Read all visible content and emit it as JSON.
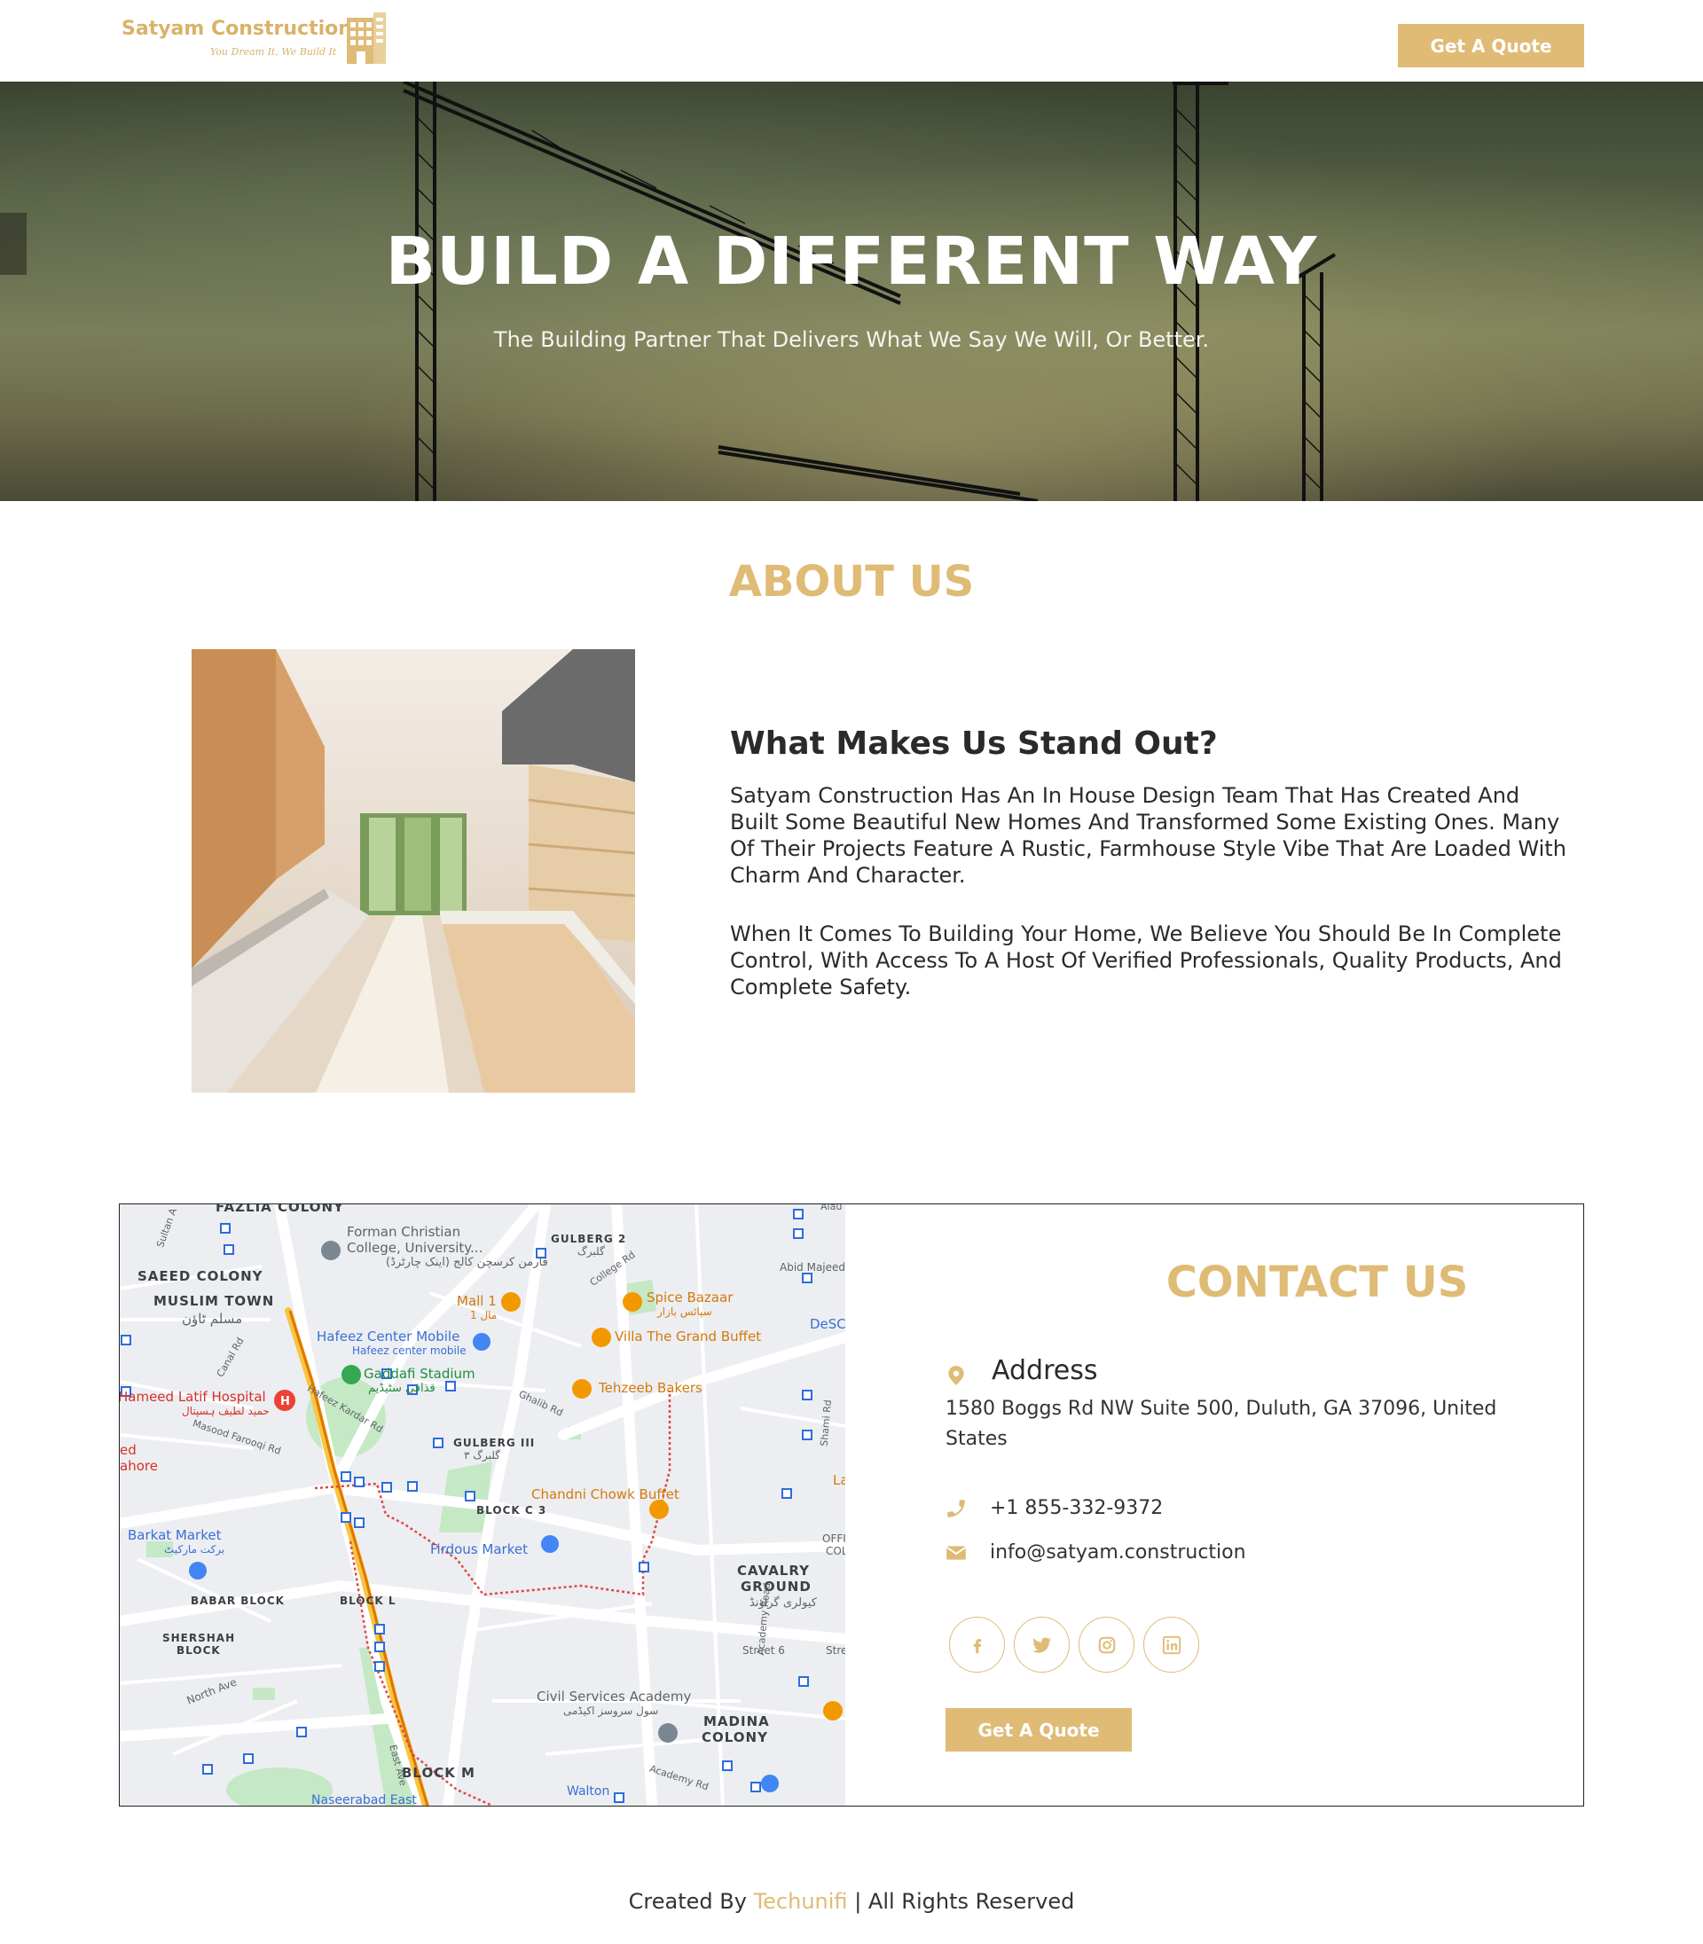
{
  "header": {
    "logo_title": "Satyam Construction",
    "logo_tagline": "You Dream It, We Build It",
    "quote_button": "Get A Quote"
  },
  "hero": {
    "title": "BUILD A DIFFERENT WAY",
    "subtitle": "The Building Partner That Delivers What We Say We Will, Or Better."
  },
  "about": {
    "title": "ABOUT US",
    "heading": "What Makes Us Stand Out?",
    "paragraph1": "Satyam Construction Has An In House Design Team That Has Created And Built Some Beautiful New Homes And Transformed Some Existing Ones. Many Of Their Projects Feature A Rustic, Farmhouse Style Vibe That Are Loaded With Charm And Character.",
    "paragraph2": "When It Comes To Building Your Home, We Believe You Should Be In Complete Control, With Access To A Host Of Verified Professionals, Quality Products, And Complete Safety."
  },
  "map": {
    "labels": {
      "fazlia": "FAZLIA COLONY",
      "forman": "Forman Christian",
      "forman2": "College, University...",
      "forman_ur": "فارمن کرسچن کالج (اینک چارٹرڈ)",
      "saeed": "SAEED COLONY",
      "muslim": "MUSLIM TOWN",
      "muslim_ur": "مسلم ٹاؤن",
      "gulberg2": "GULBERG 2",
      "gulberg2_ur": "گلبرگ",
      "mall1": "Mall 1",
      "mall1_ur": "مال 1",
      "spice": "Spice Bazaar",
      "spice_ur": "سپائس بازار",
      "abid": "Abid Majeed",
      "hafeez": "Hafeez Center Mobile",
      "hafeez2": "Hafeez center mobile",
      "villa": "Villa The Grand Buffet",
      "desc": "DeSC",
      "gaddafi": "Gaddafi Stadium",
      "gaddafi_ur": "قذافی سٹیڈیم",
      "hameed": "Hameed Latif Hospital",
      "hameed_ur": "حمید لطیف ہسپتال",
      "tehzeeb": "Tehzeeb Bakers",
      "gulberg3": "GULBERG III",
      "gulberg3_ur": "گلبرگ ۳",
      "ed": "ed",
      "ahore": "ahore",
      "chandni": "Chandni Chowk Buffet",
      "la": "La",
      "block_c3": "BLOCK C 3",
      "barkat": "Barkat Market",
      "barkat_ur": "برکت مارکیٹ",
      "firdous": "Firdous Market",
      "offi": "OFFI",
      "col": "COL",
      "cavalry": "CAVALRY",
      "ground": "GROUND",
      "cavalry_ur": "کیولری گراؤنڈ",
      "babar": "BABAR BLOCK",
      "block_l": "BLOCK L",
      "shershah": "SHERSHAH",
      "shershah2": "BLOCK",
      "street6": "Street 6",
      "stre": "Stre",
      "north_ave": "North Ave",
      "civil": "Civil Services Academy",
      "civil_ur": "سول سروسز اکیڈمی",
      "madina": "MADINA",
      "colony": "COLONY",
      "block_m": "BLOCK M",
      "walton": "Walton",
      "naseerabad": "Naseerabad East",
      "sultan": "Sultan A",
      "canal": "Canal Rd",
      "hafeez_kardar": "Hafeez Kardar Rd",
      "masood": "Masood Farooqi Rd",
      "ghalib": "Ghalib Rd",
      "college": "College Rd",
      "shami": "Shami Rd",
      "academy": "Academy Road",
      "academy_rd": "Academy Rd",
      "east_ave": "East Ave",
      "alau": "Alau"
    }
  },
  "contact": {
    "title": "CONTACT US",
    "address_label": "Address",
    "address": "1580 Boggs Rd NW Suite 500, Duluth, GA 37096, United States",
    "phone": "+1 855-332-9372",
    "email": "info@satyam.construction",
    "quote_button": "Get A Quote"
  },
  "footer": {
    "prefix": "Created By",
    "brand": "Techunifi",
    "suffix": "| All Rights Reserved"
  },
  "colors": {
    "accent": "#dfbb75",
    "text": "#2a2a2a"
  },
  "icons": [
    "building-logo-icon",
    "map-pin-icon",
    "phone-icon",
    "envelope-icon",
    "facebook-icon",
    "twitter-icon",
    "instagram-icon",
    "linkedin-icon"
  ]
}
